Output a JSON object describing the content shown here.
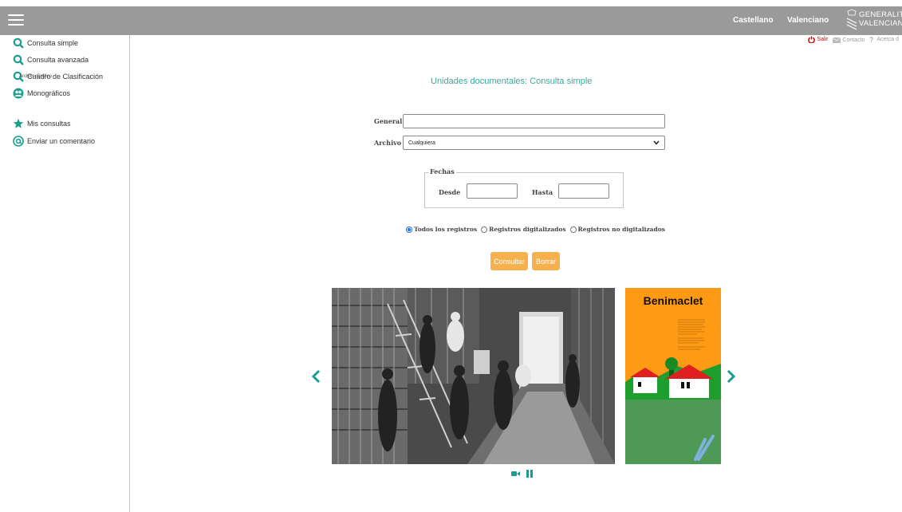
{
  "header": {
    "languages": [
      "Castellano",
      "Valenciano"
    ],
    "logo_lines": [
      "GENERALITAT",
      "VALENCIANA"
    ]
  },
  "util_links": {
    "logout": "Salir",
    "contact": "Contacto",
    "about": "Acerca d"
  },
  "sidebar": {
    "items": [
      {
        "label": "Consulta simple",
        "icon": "search-icon"
      },
      {
        "label": "Consulta avanzada",
        "icon": "search-icon"
      },
      {
        "label": "Cuadro de Clasificación",
        "icon": "search-icon"
      },
      {
        "label": "Monográficos",
        "icon": "group-icon"
      }
    ],
    "section_label": "Archivo Gráfico",
    "items2": [
      {
        "label": "Mis consultas",
        "icon": "star-icon"
      },
      {
        "label": "Enviar un comentario",
        "icon": "at-icon"
      }
    ]
  },
  "main": {
    "title": "Unidades documentales: Consulta simple",
    "general_label": "General",
    "general_value": "",
    "archivo_label": "Archivo",
    "archivo_value": "Cualquiera",
    "fechas_legend": "Fechas",
    "desde_label": "Desde",
    "hasta_label": "Hasta",
    "radios": [
      {
        "label": "Todos los registros",
        "checked": true
      },
      {
        "label": "Registros digitalizados",
        "checked": false
      },
      {
        "label": "Registros no digitalizados",
        "checked": false
      }
    ],
    "consultar_label": "Consultar",
    "borrar_label": "Borrar"
  },
  "carousel": {
    "poster_title": "Benimaclet"
  },
  "colors": {
    "topbar": "#9a9a9a",
    "accent": "#3aa99f",
    "button": "#f6b04e",
    "teal_icon": "#1a9e8f"
  }
}
